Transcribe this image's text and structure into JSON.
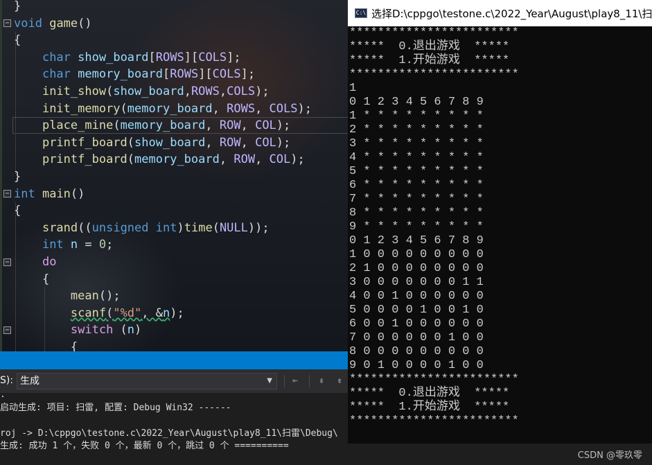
{
  "editor": {
    "lines": [
      [
        [
          "tok-text",
          "}"
        ]
      ],
      [
        [
          "tok-kw",
          "void"
        ],
        [
          "tok-text",
          " "
        ],
        [
          "tok-fn",
          "game"
        ],
        [
          "tok-text",
          "()"
        ]
      ],
      [
        [
          "tok-text",
          "{"
        ]
      ],
      [
        [
          "tok-text",
          "    "
        ],
        [
          "tok-kw",
          "char"
        ],
        [
          "tok-text",
          " "
        ],
        [
          "tok-var",
          "show_board"
        ],
        [
          "tok-text",
          "["
        ],
        [
          "tok-macro",
          "ROWS"
        ],
        [
          "tok-text",
          "]["
        ],
        [
          "tok-macro",
          "COLS"
        ],
        [
          "tok-text",
          "];"
        ]
      ],
      [
        [
          "tok-text",
          "    "
        ],
        [
          "tok-kw",
          "char"
        ],
        [
          "tok-text",
          " "
        ],
        [
          "tok-var",
          "memory_board"
        ],
        [
          "tok-text",
          "["
        ],
        [
          "tok-macro",
          "ROWS"
        ],
        [
          "tok-text",
          "]["
        ],
        [
          "tok-macro",
          "COLS"
        ],
        [
          "tok-text",
          "];"
        ]
      ],
      [
        [
          "tok-text",
          "    "
        ],
        [
          "tok-fn",
          "init_show"
        ],
        [
          "tok-text",
          "("
        ],
        [
          "tok-var",
          "show_board"
        ],
        [
          "tok-text",
          ","
        ],
        [
          "tok-macro",
          "ROWS"
        ],
        [
          "tok-text",
          ","
        ],
        [
          "tok-macro",
          "COLS"
        ],
        [
          "tok-text",
          ");"
        ]
      ],
      [
        [
          "tok-text",
          "    "
        ],
        [
          "tok-fn",
          "init_memory"
        ],
        [
          "tok-text",
          "("
        ],
        [
          "tok-var",
          "memory_board"
        ],
        [
          "tok-text",
          ", "
        ],
        [
          "tok-macro",
          "ROWS"
        ],
        [
          "tok-text",
          ", "
        ],
        [
          "tok-macro",
          "COLS"
        ],
        [
          "tok-text",
          ");"
        ]
      ],
      [
        [
          "tok-text",
          "    "
        ],
        [
          "tok-fn",
          "place_mine"
        ],
        [
          "tok-text",
          "("
        ],
        [
          "tok-var",
          "memory_board"
        ],
        [
          "tok-text",
          ", "
        ],
        [
          "tok-macro",
          "ROW"
        ],
        [
          "tok-text",
          ", "
        ],
        [
          "tok-macro",
          "COL"
        ],
        [
          "tok-text",
          ");"
        ]
      ],
      [
        [
          "tok-text",
          "    "
        ],
        [
          "tok-fn",
          "printf_board"
        ],
        [
          "tok-text",
          "("
        ],
        [
          "tok-var",
          "show_board"
        ],
        [
          "tok-text",
          ", "
        ],
        [
          "tok-macro",
          "ROW"
        ],
        [
          "tok-text",
          ", "
        ],
        [
          "tok-macro",
          "COL"
        ],
        [
          "tok-text",
          ");"
        ]
      ],
      [
        [
          "tok-text",
          "    "
        ],
        [
          "tok-fn",
          "printf_board"
        ],
        [
          "tok-text",
          "("
        ],
        [
          "tok-var",
          "memory_board"
        ],
        [
          "tok-text",
          ", "
        ],
        [
          "tok-macro",
          "ROW"
        ],
        [
          "tok-text",
          ", "
        ],
        [
          "tok-macro",
          "COL"
        ],
        [
          "tok-text",
          ");"
        ]
      ],
      [
        [
          "tok-text",
          "}"
        ]
      ],
      [
        [
          "tok-kw",
          "int"
        ],
        [
          "tok-text",
          " "
        ],
        [
          "tok-fn",
          "main"
        ],
        [
          "tok-text",
          "()"
        ]
      ],
      [
        [
          "tok-text",
          "{"
        ]
      ],
      [
        [
          "tok-text",
          "    "
        ],
        [
          "tok-fn",
          "srand"
        ],
        [
          "tok-text",
          "(("
        ],
        [
          "tok-kw",
          "unsigned"
        ],
        [
          "tok-text",
          " "
        ],
        [
          "tok-kw",
          "int"
        ],
        [
          "tok-text",
          ")"
        ],
        [
          "tok-fn",
          "time"
        ],
        [
          "tok-text",
          "("
        ],
        [
          "tok-macro",
          "NULL"
        ],
        [
          "tok-text",
          "));"
        ]
      ],
      [
        [
          "tok-text",
          "    "
        ],
        [
          "tok-kw",
          "int"
        ],
        [
          "tok-text",
          " "
        ],
        [
          "tok-var",
          "n"
        ],
        [
          "tok-text",
          " = "
        ],
        [
          "tok-num",
          "0"
        ],
        [
          "tok-text",
          ";"
        ]
      ],
      [
        [
          "tok-text",
          "    "
        ],
        [
          "tok-pl",
          "do"
        ]
      ],
      [
        [
          "tok-text",
          "    {"
        ]
      ],
      [
        [
          "tok-text",
          "        "
        ],
        [
          "tok-fn",
          "mean"
        ],
        [
          "tok-text",
          "();"
        ]
      ],
      [
        [
          "tok-text",
          "        "
        ],
        [
          "tok-fn squiggle",
          "scanf"
        ],
        [
          "tok-text squiggle",
          "("
        ],
        [
          "tok-str squiggle",
          "\"%d\""
        ],
        [
          "tok-text squiggle",
          ", &"
        ],
        [
          "tok-var squiggle",
          "n"
        ],
        [
          "tok-text",
          ");"
        ]
      ],
      [
        [
          "tok-text",
          "        "
        ],
        [
          "tok-pl",
          "switch"
        ],
        [
          "tok-text",
          " ("
        ],
        [
          "tok-var",
          "n"
        ],
        [
          "tok-text",
          ")"
        ]
      ],
      [
        [
          "tok-text",
          "        {"
        ]
      ]
    ]
  },
  "output_panel": {
    "show_output_from_label": "S):",
    "show_output_from_value": "生成",
    "lines": [
      ".",
      "启动生成: 项目: 扫雷, 配置: Debug Win32 ------",
      "",
      "roj -> D:\\cppgo\\testone.c\\2022_Year\\August\\play8_11\\扫雷\\Debug\\",
      "生成: 成功 1 个，失败 0 个，最新 0 个，跳过 0 个 =========="
    ]
  },
  "console": {
    "icon_text": "C:\\",
    "title": "选择D:\\cppgo\\testone.c\\2022_Year\\August\\play8_11\\扫",
    "lines": [
      "************************",
      "*****  0.退出游戏  *****",
      "*****  1.开始游戏  *****",
      "************************",
      "1",
      "0 1 2 3 4 5 6 7 8 9",
      "1 * * * * * * * * *",
      "2 * * * * * * * * *",
      "3 * * * * * * * * *",
      "4 * * * * * * * * *",
      "5 * * * * * * * * *",
      "6 * * * * * * * * *",
      "7 * * * * * * * * *",
      "8 * * * * * * * * *",
      "9 * * * * * * * * *",
      "0 1 2 3 4 5 6 7 8 9",
      "1 0 0 0 0 0 0 0 0 0",
      "2 1 0 0 0 0 0 0 0 0",
      "3 0 0 0 0 0 0 0 1 1",
      "4 0 0 1 0 0 0 0 0 0",
      "5 0 0 0 0 1 0 0 1 0",
      "6 0 0 1 0 0 0 0 0 0",
      "7 0 0 0 0 0 0 1 0 0",
      "8 0 0 0 0 0 0 0 0 0",
      "9 0 1 0 0 0 0 1 0 0",
      "************************",
      "*****  0.退出游戏  *****",
      "*****  1.开始游戏  *****",
      "************************"
    ]
  },
  "watermark": "CSDN @零玖零"
}
